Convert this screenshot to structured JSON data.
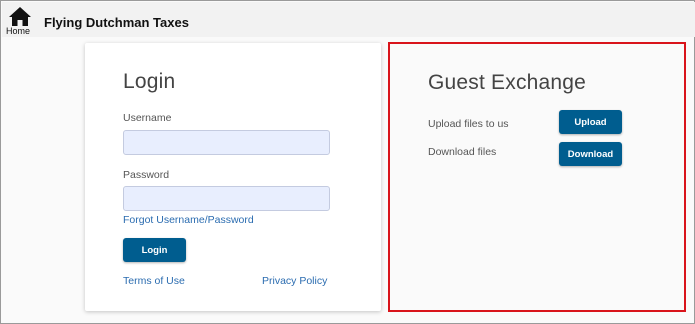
{
  "header": {
    "home_label": "Home",
    "app_title": "Flying Dutchman Taxes"
  },
  "login": {
    "title": "Login",
    "username_label": "Username",
    "username_value": "",
    "password_label": "Password",
    "password_value": "",
    "forgot_link": "Forgot Username/Password",
    "login_button": "Login",
    "terms_link": "Terms of Use",
    "privacy_link": "Privacy Policy"
  },
  "guest": {
    "title": "Guest Exchange",
    "upload_text": "Upload files to us",
    "upload_button": "Upload",
    "download_text": "Download files",
    "download_button": "Download"
  },
  "colors": {
    "button": "#005d8f",
    "link": "#2b6cb0",
    "input_bg": "#e8eefe",
    "highlight_border": "#d9141b"
  },
  "icons": {
    "home": "home-icon"
  }
}
